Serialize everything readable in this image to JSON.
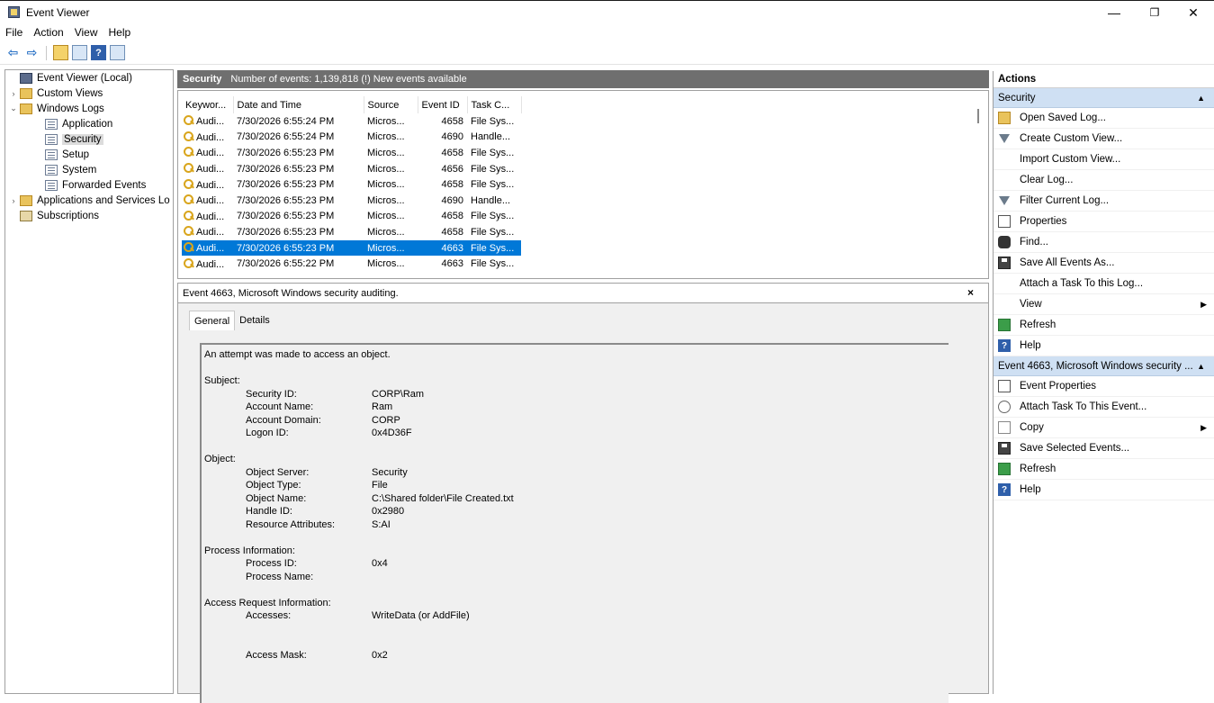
{
  "window": {
    "title": "Event Viewer",
    "minimize": "—",
    "restore": "❐",
    "close": "✕"
  },
  "menu": [
    "File",
    "Action",
    "View",
    "Help"
  ],
  "toolbar": {
    "back": "⇦",
    "forward": "⇨",
    "help": "?"
  },
  "tree": [
    {
      "label": "Event Viewer (Local)",
      "exp": "",
      "icon": "viewer",
      "indent": 0
    },
    {
      "label": "Custom Views",
      "exp": "›",
      "icon": "folder",
      "indent": 0
    },
    {
      "label": "Windows Logs",
      "exp": "⌄",
      "icon": "folder",
      "indent": 0
    },
    {
      "label": "Application",
      "exp": "",
      "icon": "log",
      "indent": 2
    },
    {
      "label": "Security",
      "exp": "",
      "icon": "log",
      "indent": 2,
      "selected": true
    },
    {
      "label": "Setup",
      "exp": "",
      "icon": "log",
      "indent": 2
    },
    {
      "label": "System",
      "exp": "",
      "icon": "log",
      "indent": 2
    },
    {
      "label": "Forwarded Events",
      "exp": "",
      "icon": "log",
      "indent": 2
    },
    {
      "label": "Applications and Services Lo",
      "exp": "›",
      "icon": "folder",
      "indent": 0
    },
    {
      "label": "Subscriptions",
      "exp": "",
      "icon": "sub",
      "indent": 0
    }
  ],
  "center": {
    "log_name": "Security",
    "count_text": "Number of events: 1,139,818 (!) New events available"
  },
  "events": {
    "columns": [
      "Keywor...",
      "Date and Time",
      "Source",
      "Event ID",
      "Task C..."
    ],
    "rows": [
      {
        "keyword": "Audi...",
        "date": "7/30/2026 6:55:24 PM",
        "source": "Micros...",
        "id": "4658",
        "task": "File Sys..."
      },
      {
        "keyword": "Audi...",
        "date": "7/30/2026 6:55:24 PM",
        "source": "Micros...",
        "id": "4690",
        "task": "Handle..."
      },
      {
        "keyword": "Audi...",
        "date": "7/30/2026 6:55:23 PM",
        "source": "Micros...",
        "id": "4658",
        "task": "File Sys..."
      },
      {
        "keyword": "Audi...",
        "date": "7/30/2026 6:55:23 PM",
        "source": "Micros...",
        "id": "4656",
        "task": "File Sys..."
      },
      {
        "keyword": "Audi...",
        "date": "7/30/2026 6:55:23 PM",
        "source": "Micros...",
        "id": "4658",
        "task": "File Sys..."
      },
      {
        "keyword": "Audi...",
        "date": "7/30/2026 6:55:23 PM",
        "source": "Micros...",
        "id": "4690",
        "task": "Handle..."
      },
      {
        "keyword": "Audi...",
        "date": "7/30/2026 6:55:23 PM",
        "source": "Micros...",
        "id": "4658",
        "task": "File Sys..."
      },
      {
        "keyword": "Audi...",
        "date": "7/30/2026 6:55:23 PM",
        "source": "Micros...",
        "id": "4658",
        "task": "File Sys..."
      },
      {
        "keyword": "Audi...",
        "date": "7/30/2026 6:55:23 PM",
        "source": "Micros...",
        "id": "4663",
        "task": "File Sys...",
        "selected": true
      },
      {
        "keyword": "Audi...",
        "date": "7/30/2026 6:55:22 PM",
        "source": "Micros...",
        "id": "4663",
        "task": "File Sys..."
      }
    ]
  },
  "detail": {
    "title": "Event 4663, Microsoft Windows security auditing.",
    "close": "×",
    "tabs": [
      "General",
      "Details"
    ],
    "lines": [
      {
        "type": "text",
        "text": "An attempt was made to access an object."
      },
      {
        "type": "gap"
      },
      {
        "type": "text",
        "text": "Subject:"
      },
      {
        "type": "kv",
        "k": "Security ID:",
        "v": "CORP\\Ram"
      },
      {
        "type": "kv",
        "k": "Account Name:",
        "v": "Ram"
      },
      {
        "type": "kv",
        "k": "Account Domain:",
        "v": "CORP"
      },
      {
        "type": "kv",
        "k": "Logon ID:",
        "v": "0x4D36F"
      },
      {
        "type": "gap"
      },
      {
        "type": "text",
        "text": "Object:"
      },
      {
        "type": "kv",
        "k": "Object Server:",
        "v": "Security"
      },
      {
        "type": "kv",
        "k": "Object Type:",
        "v": "File"
      },
      {
        "type": "kv",
        "k": "Object Name:",
        "v": "C:\\Shared folder\\File Created.txt"
      },
      {
        "type": "kv",
        "k": "Handle ID:",
        "v": "0x2980"
      },
      {
        "type": "kv",
        "k": "Resource Attributes:",
        "v": "S:AI"
      },
      {
        "type": "gap"
      },
      {
        "type": "text",
        "text": "Process Information:"
      },
      {
        "type": "kv",
        "k": "Process ID:",
        "v": "0x4"
      },
      {
        "type": "kv",
        "k": "Process Name:",
        "v": ""
      },
      {
        "type": "gap"
      },
      {
        "type": "text",
        "text": "Access Request Information:"
      },
      {
        "type": "kv",
        "k": "Accesses:",
        "v": "WriteData (or AddFile)"
      },
      {
        "type": "gap"
      },
      {
        "type": "gap"
      },
      {
        "type": "kv",
        "k": "Access Mask:",
        "v": "0x2"
      }
    ]
  },
  "actions": {
    "title": "Actions",
    "groups": [
      {
        "label": "Security",
        "caret": "▲",
        "items": [
          {
            "label": "Open Saved Log...",
            "icon": "open"
          },
          {
            "label": "Create Custom View...",
            "icon": "filter"
          },
          {
            "label": "Import Custom View...",
            "icon": "blank"
          },
          {
            "label": "Clear Log...",
            "icon": "blank"
          },
          {
            "label": "Filter Current Log...",
            "icon": "filter"
          },
          {
            "label": "Properties",
            "icon": "props"
          },
          {
            "label": "Find...",
            "icon": "find"
          },
          {
            "label": "Save All Events As...",
            "icon": "save"
          },
          {
            "label": "Attach a Task To this Log...",
            "icon": "blank"
          },
          {
            "label": "View",
            "icon": "blank",
            "submenu": "▶"
          },
          {
            "label": "Refresh",
            "icon": "refresh"
          },
          {
            "label": "Help",
            "icon": "help"
          }
        ]
      },
      {
        "label": "Event 4663, Microsoft Windows security ...",
        "caret": "▲",
        "items": [
          {
            "label": "Event Properties",
            "icon": "props"
          },
          {
            "label": "Attach Task To This Event...",
            "icon": "task"
          },
          {
            "label": "Copy",
            "icon": "copy",
            "submenu": "▶"
          },
          {
            "label": "Save Selected Events...",
            "icon": "save"
          },
          {
            "label": "Refresh",
            "icon": "refresh"
          },
          {
            "label": "Help",
            "icon": "help"
          }
        ]
      }
    ]
  }
}
